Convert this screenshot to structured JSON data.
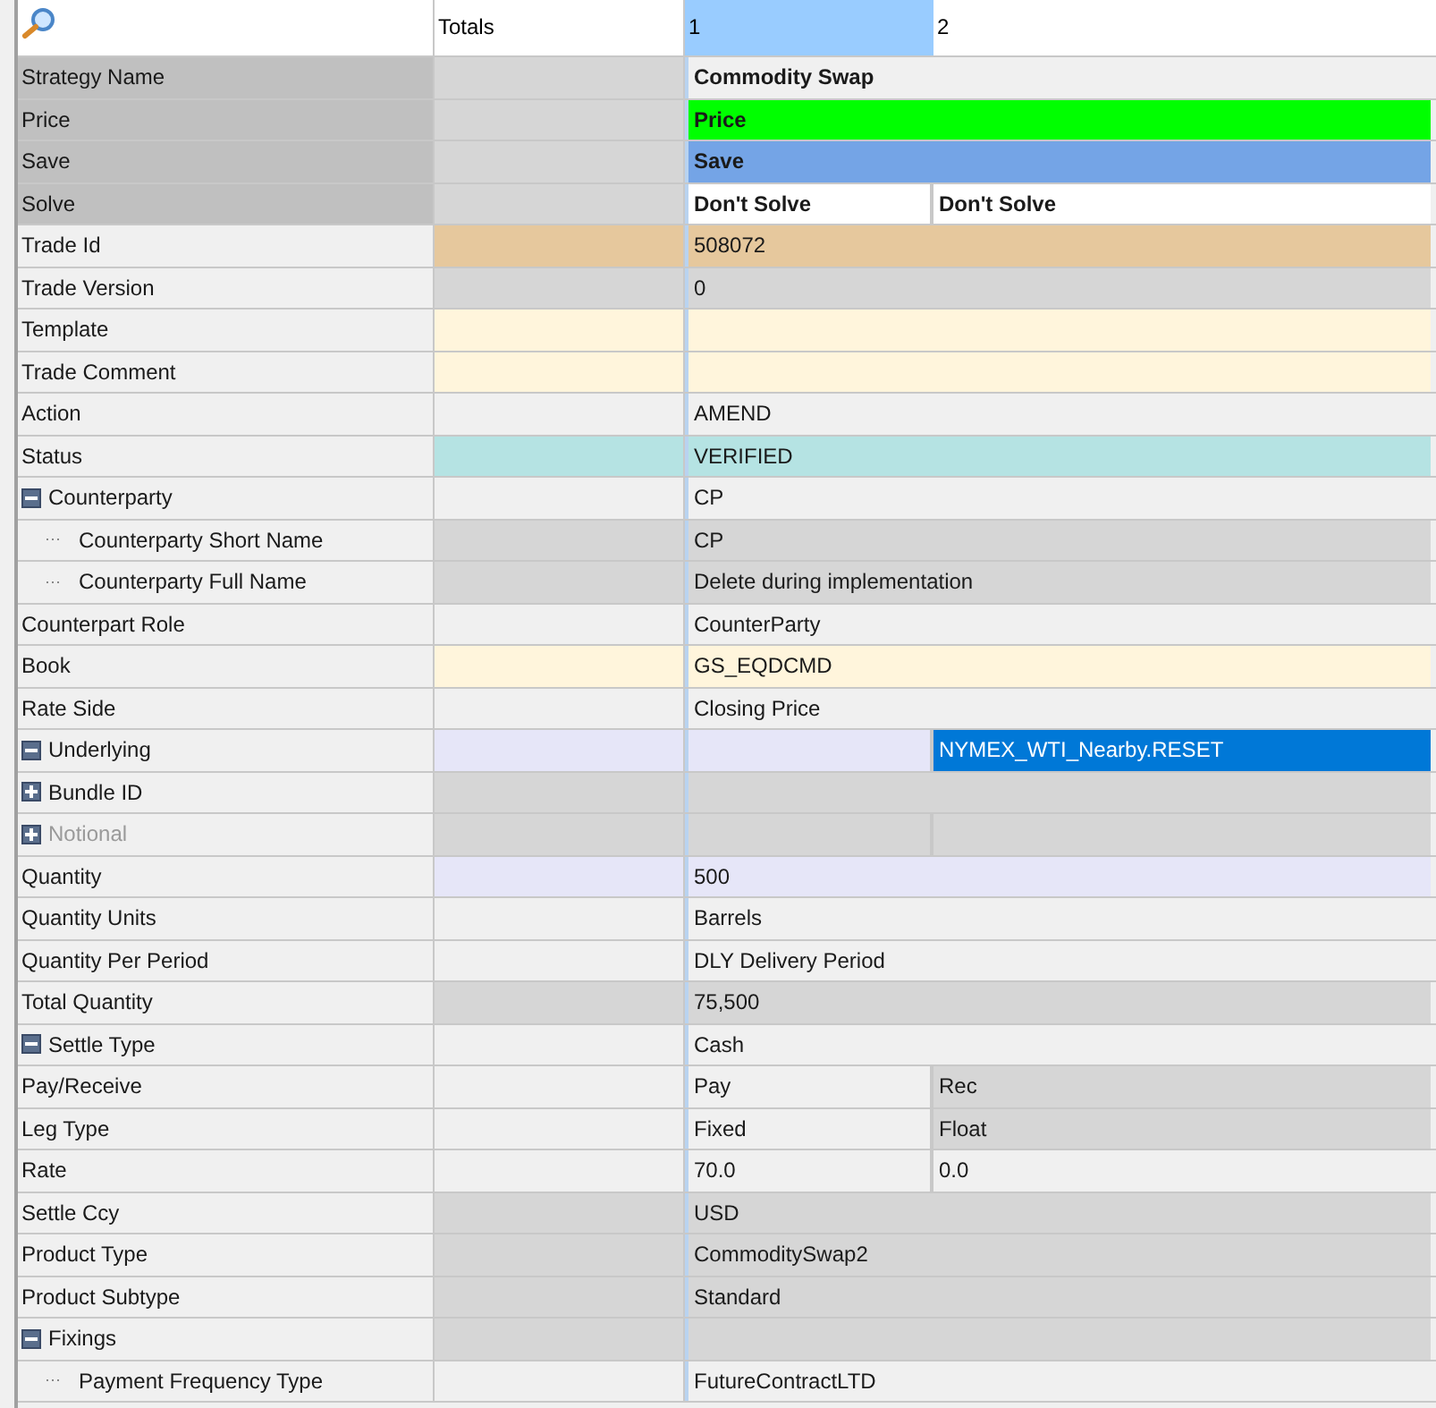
{
  "header": {
    "columns": [
      {
        "label": "Totals",
        "selected": false
      },
      {
        "label": "1",
        "selected": true
      },
      {
        "label": "2",
        "selected": false
      }
    ]
  },
  "rows": [
    {
      "label": "Strategy Name",
      "color": "#c0c0c0",
      "totals": {
        "color": "#d6d6d6"
      },
      "values": [
        {
          "text": "Commodity Swap",
          "color": "#f0f0f0",
          "bold": true
        }
      ]
    },
    {
      "label": "Price",
      "color": "#c0c0c0",
      "totals": {
        "color": "#d6d6d6"
      },
      "values": [
        {
          "text": "Price",
          "color": "#00ff00",
          "bold": true
        }
      ]
    },
    {
      "label": "Save",
      "color": "#c0c0c0",
      "totals": {
        "color": "#d6d6d6"
      },
      "values": [
        {
          "text": "Save",
          "color": "#74a4e6",
          "bold": true
        }
      ]
    },
    {
      "label": "Solve",
      "color": "#c0c0c0",
      "totals": {
        "color": "#d6d6d6"
      },
      "values": [
        {
          "text": "Don't Solve",
          "color": "#ffffff",
          "bold": true
        },
        {
          "text": "Don't Solve",
          "color": "#ffffff",
          "bold": true
        }
      ]
    },
    {
      "label": "Trade Id",
      "color": "#f0f0f0",
      "totals": {
        "color": "#e6c89d"
      },
      "values": [
        {
          "text": "508072",
          "color": "#e6c89d"
        }
      ]
    },
    {
      "label": "Trade Version",
      "color": "#f0f0f0",
      "totals": {
        "color": "#d6d6d6"
      },
      "values": [
        {
          "text": "0",
          "color": "#d6d6d6"
        }
      ]
    },
    {
      "label": "Template",
      "color": "#f0f0f0",
      "totals": {
        "color": "#fff5dc"
      },
      "values": [
        {
          "color": "#fff5dc"
        }
      ]
    },
    {
      "label": "Trade Comment",
      "color": "#f0f0f0",
      "totals": {
        "color": "#fff5dc"
      },
      "values": [
        {
          "color": "#fff5dc"
        }
      ]
    },
    {
      "label": "Action",
      "color": "#f0f0f0",
      "totals": {
        "color": "#f0f0f0"
      },
      "values": [
        {
          "text": "AMEND",
          "color": "#f0f0f0"
        }
      ]
    },
    {
      "label": "Status",
      "color": "#f0f0f0",
      "totals": {
        "color": "#b5e3e3"
      },
      "values": [
        {
          "text": "VERIFIED",
          "color": "#b5e3e3"
        }
      ]
    },
    {
      "label": "Counterparty",
      "color": "#f0f0f0",
      "expanded": true,
      "totals": {
        "color": "#f0f0f0"
      },
      "values": [
        {
          "text": "CP",
          "color": "#f0f0f0"
        }
      ],
      "children": [
        {
          "label": "Counterparty Short Name",
          "color": "#f0f0f0",
          "totals": {
            "color": "#d6d6d6"
          },
          "values": [
            {
              "text": "CP",
              "color": "#d6d6d6"
            }
          ]
        },
        {
          "label": "Counterparty Full Name",
          "color": "#f0f0f0",
          "totals": {
            "color": "#d6d6d6"
          },
          "values": [
            {
              "text": "Delete during implementation",
              "color": "#d6d6d6"
            }
          ]
        }
      ]
    },
    {
      "label": "Counterpart Role",
      "color": "#f0f0f0",
      "totals": {
        "color": "#f0f0f0"
      },
      "values": [
        {
          "text": "CounterParty",
          "color": "#f0f0f0"
        }
      ]
    },
    {
      "label": "Book",
      "color": "#f0f0f0",
      "totals": {
        "color": "#fff5dc"
      },
      "values": [
        {
          "text": "GS_EQDCMD",
          "color": "#fff5dc"
        }
      ]
    },
    {
      "label": "Rate Side",
      "color": "#f0f0f0",
      "totals": {
        "color": "#f0f0f0"
      },
      "values": [
        {
          "text": "Closing Price",
          "color": "#f0f0f0"
        }
      ]
    },
    {
      "label": "Underlying",
      "color": "#f0f0f0",
      "expanded": true,
      "totals": {
        "color": "#e6e6f8"
      },
      "values": [
        {
          "color": "#e6e6f8"
        },
        {
          "text": "NYMEX_WTI_Nearby.RESET",
          "color": "#0078d7"
        }
      ]
    },
    {
      "label": "Bundle ID",
      "color": "#f0f0f0",
      "expanded": false,
      "totals": {
        "color": "#d6d6d6"
      },
      "values": [
        {
          "color": "#d6d6d6"
        }
      ]
    },
    {
      "label": "Notional",
      "color": "#f0f0f0",
      "expanded": false,
      "disabled": true,
      "totals": {
        "color": "#d6d6d6"
      },
      "values": [
        {
          "color": "#d6d6d6"
        },
        {
          "color": "#d6d6d6"
        }
      ]
    },
    {
      "label": "Quantity",
      "color": "#f0f0f0",
      "totals": {
        "color": "#e6e6f8"
      },
      "values": [
        {
          "text": "500",
          "color": "#e6e6f8"
        }
      ]
    },
    {
      "label": "Quantity Units",
      "color": "#f0f0f0",
      "totals": {
        "color": "#f0f0f0"
      },
      "values": [
        {
          "text": "Barrels",
          "color": "#f0f0f0"
        }
      ]
    },
    {
      "label": "Quantity Per Period",
      "color": "#f0f0f0",
      "totals": {
        "color": "#f0f0f0"
      },
      "values": [
        {
          "text": "DLY Delivery Period",
          "color": "#f0f0f0"
        }
      ]
    },
    {
      "label": "Total Quantity",
      "color": "#f0f0f0",
      "totals": {
        "color": "#d6d6d6"
      },
      "values": [
        {
          "text": "75,500",
          "color": "#d6d6d6"
        }
      ]
    },
    {
      "label": "Settle Type",
      "color": "#f0f0f0",
      "expanded": true,
      "totals": {
        "color": "#f0f0f0"
      },
      "values": [
        {
          "text": "Cash",
          "color": "#f0f0f0"
        }
      ]
    },
    {
      "label": "Pay/Receive",
      "color": "#f0f0f0",
      "totals": {
        "color": "#f0f0f0"
      },
      "values": [
        {
          "text": "Pay",
          "color": "#f0f0f0"
        },
        {
          "text": "Rec",
          "color": "#d6d6d6"
        }
      ]
    },
    {
      "label": "Leg Type",
      "color": "#f0f0f0",
      "totals": {
        "color": "#f0f0f0"
      },
      "values": [
        {
          "text": "Fixed",
          "color": "#f0f0f0"
        },
        {
          "text": "Float",
          "color": "#d6d6d6"
        }
      ]
    },
    {
      "label": "Rate",
      "color": "#f0f0f0",
      "totals": {
        "color": "#f0f0f0"
      },
      "values": [
        {
          "text": "70.0",
          "color": "#f0f0f0"
        },
        {
          "text": "0.0",
          "color": "#f0f0f0"
        }
      ]
    },
    {
      "label": "Settle Ccy",
      "color": "#f0f0f0",
      "totals": {
        "color": "#d6d6d6"
      },
      "values": [
        {
          "text": "USD",
          "color": "#d6d6d6"
        }
      ]
    },
    {
      "label": "Product Type",
      "color": "#f0f0f0",
      "totals": {
        "color": "#d6d6d6"
      },
      "values": [
        {
          "text": "CommoditySwap2",
          "color": "#d6d6d6"
        }
      ]
    },
    {
      "label": "Product Subtype",
      "color": "#f0f0f0",
      "totals": {
        "color": "#d6d6d6"
      },
      "values": [
        {
          "text": "Standard",
          "color": "#d6d6d6"
        }
      ]
    },
    {
      "label": "Fixings",
      "color": "#f0f0f0",
      "expanded": true,
      "totals": {
        "color": "#d6d6d6"
      },
      "values": [
        {
          "color": "#d6d6d6"
        }
      ],
      "children": [
        {
          "label": "Payment Frequency Type",
          "color": "#f0f0f0",
          "totals": {
            "color": "#f0f0f0"
          },
          "values": [
            {
              "text": "FutureContractLTD",
              "color": "#f0f0f0"
            }
          ]
        }
      ]
    }
  ]
}
